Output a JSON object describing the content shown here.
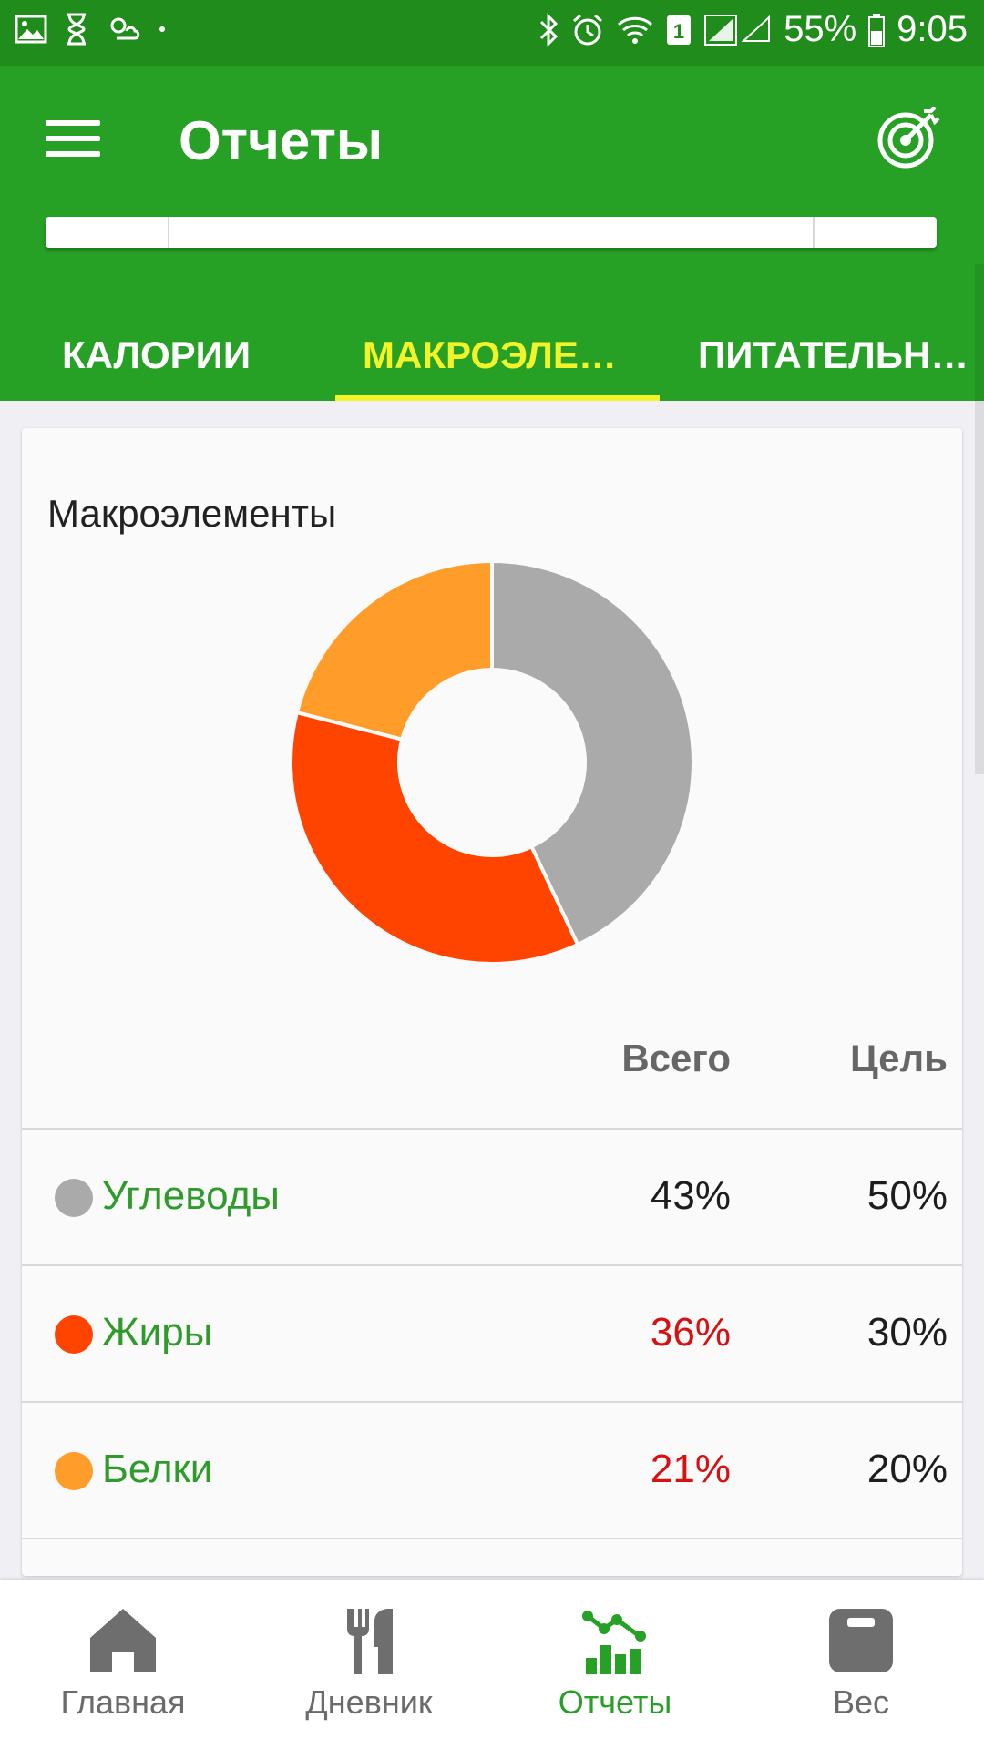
{
  "status_bar": {
    "battery_percent": "55%",
    "time": "9:05",
    "sim_badge": "1",
    "left_icons": [
      "gallery-icon",
      "hourglass-icon",
      "weather-icon"
    ],
    "right_icons": [
      "bluetooth-icon",
      "alarm-icon",
      "wifi-icon",
      "signal-icon",
      "battery-icon"
    ]
  },
  "app_bar": {
    "title": "Отчеты",
    "menu_icon": "hamburger-menu-icon",
    "goal_icon": "target-icon"
  },
  "tabs": [
    {
      "label": "КАЛОРИИ",
      "active": false
    },
    {
      "label": "МАКРОЭЛЕ…",
      "active": true
    },
    {
      "label": "ПИТАТЕЛЬН…",
      "active": false
    }
  ],
  "card": {
    "title": "Макроэлементы",
    "col_total": "Всего",
    "col_goal": "Цель"
  },
  "chart_data": {
    "type": "pie",
    "categories": [
      "Углеводы",
      "Жиры",
      "Белки"
    ],
    "values": [
      43,
      36,
      21
    ],
    "colors": [
      "#aaaaaa",
      "#ff4400",
      "#ff9c2a"
    ],
    "donut": true
  },
  "rows": [
    {
      "label": "Углеводы",
      "total": "43%",
      "goal": "50%",
      "color": "#aaaaaa",
      "total_color": "#1d1d1d"
    },
    {
      "label": "Жиры",
      "total": "36%",
      "goal": "30%",
      "color": "#ff4400",
      "total_color": "#d81010"
    },
    {
      "label": "Белки",
      "total": "21%",
      "goal": "20%",
      "color": "#ff9c2a",
      "total_color": "#d81010"
    }
  ],
  "bottom_nav": [
    {
      "label": "Главная",
      "icon": "home-icon",
      "active": false
    },
    {
      "label": "Дневник",
      "icon": "fork-knife-icon",
      "active": false
    },
    {
      "label": "Отчеты",
      "icon": "reports-chart-icon",
      "active": true
    },
    {
      "label": "Вес",
      "icon": "scale-icon",
      "active": false
    }
  ]
}
